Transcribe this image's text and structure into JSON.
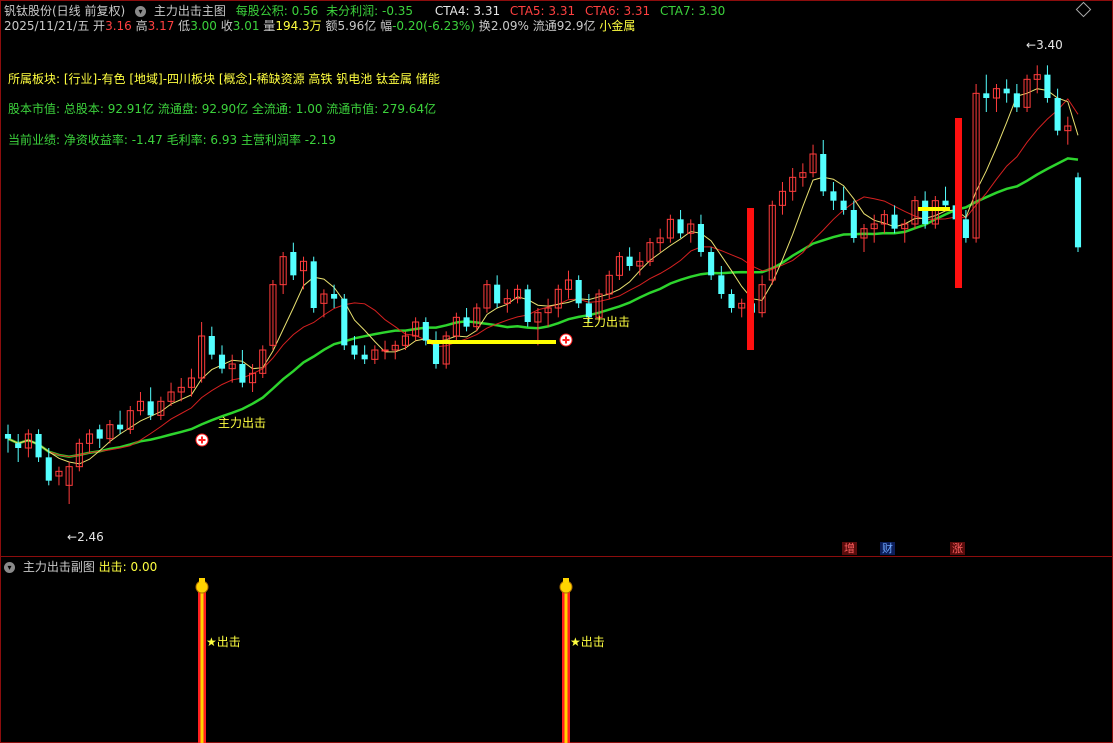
{
  "header": {
    "stock_name": "钒钛股份(日线 前复权)",
    "indicator_title": "主力出击主图",
    "eps_label": "每股公积:",
    "eps_value": "0.56",
    "undist_label": "未分利润:",
    "undist_value": "-0.35",
    "cta4_label": "CTA4:",
    "cta4_value": "3.31",
    "cta5_label": "CTA5:",
    "cta5_value": "3.31",
    "cta6_label": "CTA6:",
    "cta6_value": "3.31",
    "cta7_label": "CTA7:",
    "cta7_value": "3.30"
  },
  "quote": {
    "date": "2025/11/21/五",
    "open_label": "开",
    "open": "3.16",
    "high_label": "高",
    "high": "3.17",
    "low_label": "低",
    "low": "3.00",
    "close_label": "收",
    "close": "3.01",
    "volume_label": "量",
    "volume": "194.3万",
    "amount_label": "额",
    "amount": "5.96亿",
    "change_label": "幅",
    "change": "-0.20(-6.23%)",
    "turnover_label": "换",
    "turnover": "2.09%",
    "float_label": "流通",
    "float_value": "92.9亿",
    "sector_tag": "小金属"
  },
  "info": {
    "sector_line": "所属板块: [行业]-有色 [地域]-四川板块 [概念]-稀缺资源 高铁 钒电池 钛金属 储能",
    "capital_line": "股本市值: 总股本: 92.91亿 流通盘: 92.90亿 全流通: 1.00 流通市值: 279.64亿",
    "perf_line": "当前业绩: 净资收益率: -1.47 毛利率: 6.93 主营利润率 -2.19"
  },
  "chart_labels": {
    "signal_label_1": "主力出击",
    "signal_label_2": "主力出击",
    "max_label": "3.40",
    "min_label": "2.46",
    "badge_zeng": "增",
    "badge_cai": "财",
    "badge_zhang": "涨"
  },
  "sub_panel": {
    "title": "主力出击副图",
    "value_label": "出击:",
    "value": "0.00",
    "signal_text_1": "★出击",
    "signal_text_2": "★出击"
  },
  "colors": {
    "up": "#ff3c3c",
    "down": "#54ffff",
    "ma_green": "#2dd42d",
    "accent_yellow": "#ffff00",
    "frame": "#8c0d0d"
  },
  "icons": {
    "collapse_indicator": "chevron-down-circle-icon",
    "top_right": "diamond-icon",
    "signal_marker": "plus-circle-icon",
    "money_bag": "money-bag-icon"
  },
  "chart_data": {
    "type": "candlestick",
    "y_range": [
      2.4,
      3.45
    ],
    "max_price": 3.4,
    "min_price": 2.46,
    "candles": [
      [
        2.61,
        2.63,
        2.57,
        2.6
      ],
      [
        2.59,
        2.61,
        2.55,
        2.58
      ],
      [
        2.58,
        2.62,
        2.56,
        2.61
      ],
      [
        2.61,
        2.62,
        2.55,
        2.56
      ],
      [
        2.56,
        2.58,
        2.5,
        2.51
      ],
      [
        2.52,
        2.54,
        2.5,
        2.53
      ],
      [
        2.5,
        2.55,
        2.46,
        2.54
      ],
      [
        2.54,
        2.6,
        2.53,
        2.59
      ],
      [
        2.59,
        2.62,
        2.57,
        2.61
      ],
      [
        2.62,
        2.63,
        2.58,
        2.6
      ],
      [
        2.6,
        2.64,
        2.59,
        2.63
      ],
      [
        2.63,
        2.66,
        2.61,
        2.62
      ],
      [
        2.62,
        2.67,
        2.61,
        2.66
      ],
      [
        2.66,
        2.7,
        2.65,
        2.68
      ],
      [
        2.68,
        2.71,
        2.64,
        2.65
      ],
      [
        2.65,
        2.69,
        2.64,
        2.68
      ],
      [
        2.68,
        2.72,
        2.67,
        2.7
      ],
      [
        2.7,
        2.73,
        2.68,
        2.71
      ],
      [
        2.71,
        2.75,
        2.69,
        2.73
      ],
      [
        2.73,
        2.85,
        2.72,
        2.82
      ],
      [
        2.82,
        2.84,
        2.77,
        2.78
      ],
      [
        2.78,
        2.8,
        2.74,
        2.75
      ],
      [
        2.75,
        2.78,
        2.72,
        2.76
      ],
      [
        2.76,
        2.79,
        2.71,
        2.72
      ],
      [
        2.72,
        2.76,
        2.7,
        2.74
      ],
      [
        2.74,
        2.8,
        2.73,
        2.79
      ],
      [
        2.8,
        2.94,
        2.79,
        2.93
      ],
      [
        2.93,
        3.0,
        2.91,
        2.99
      ],
      [
        3.0,
        3.02,
        2.94,
        2.95
      ],
      [
        2.96,
        2.99,
        2.92,
        2.98
      ],
      [
        2.98,
        2.99,
        2.87,
        2.88
      ],
      [
        2.89,
        2.92,
        2.86,
        2.91
      ],
      [
        2.91,
        2.93,
        2.88,
        2.9
      ],
      [
        2.9,
        2.91,
        2.79,
        2.8
      ],
      [
        2.8,
        2.82,
        2.77,
        2.78
      ],
      [
        2.78,
        2.8,
        2.76,
        2.77
      ],
      [
        2.77,
        2.8,
        2.76,
        2.79
      ],
      [
        2.79,
        2.81,
        2.77,
        2.79
      ],
      [
        2.79,
        2.81,
        2.77,
        2.8
      ],
      [
        2.8,
        2.83,
        2.79,
        2.82
      ],
      [
        2.82,
        2.86,
        2.81,
        2.85
      ],
      [
        2.85,
        2.86,
        2.8,
        2.81
      ],
      [
        2.81,
        2.83,
        2.75,
        2.76
      ],
      [
        2.76,
        2.83,
        2.75,
        2.82
      ],
      [
        2.82,
        2.87,
        2.81,
        2.86
      ],
      [
        2.86,
        2.88,
        2.83,
        2.84
      ],
      [
        2.84,
        2.89,
        2.83,
        2.88
      ],
      [
        2.88,
        2.94,
        2.87,
        2.93
      ],
      [
        2.93,
        2.95,
        2.88,
        2.89
      ],
      [
        2.89,
        2.92,
        2.87,
        2.9
      ],
      [
        2.9,
        2.93,
        2.89,
        2.92
      ],
      [
        2.92,
        2.93,
        2.84,
        2.85
      ],
      [
        2.85,
        2.88,
        2.8,
        2.87
      ],
      [
        2.87,
        2.9,
        2.84,
        2.88
      ],
      [
        2.88,
        2.93,
        2.86,
        2.92
      ],
      [
        2.92,
        2.96,
        2.9,
        2.94
      ],
      [
        2.94,
        2.95,
        2.88,
        2.89
      ],
      [
        2.89,
        2.91,
        2.85,
        2.86
      ],
      [
        2.86,
        2.92,
        2.85,
        2.91
      ],
      [
        2.91,
        2.96,
        2.9,
        2.95
      ],
      [
        2.95,
        3.0,
        2.94,
        2.99
      ],
      [
        2.99,
        3.01,
        2.96,
        2.97
      ],
      [
        2.97,
        3.0,
        2.95,
        2.98
      ],
      [
        2.98,
        3.03,
        2.97,
        3.02
      ],
      [
        3.02,
        3.05,
        3.0,
        3.03
      ],
      [
        3.03,
        3.08,
        3.02,
        3.07
      ],
      [
        3.07,
        3.09,
        3.03,
        3.04
      ],
      [
        3.04,
        3.07,
        3.02,
        3.06
      ],
      [
        3.06,
        3.08,
        2.99,
        3.0
      ],
      [
        3.0,
        3.01,
        2.94,
        2.95
      ],
      [
        2.95,
        2.97,
        2.9,
        2.91
      ],
      [
        2.91,
        2.92,
        2.87,
        2.88
      ],
      [
        2.88,
        2.9,
        2.86,
        2.89
      ],
      [
        2.89,
        2.91,
        2.86,
        2.87
      ],
      [
        2.87,
        2.95,
        2.86,
        2.93
      ],
      [
        2.94,
        3.11,
        2.93,
        3.1
      ],
      [
        3.1,
        3.15,
        3.08,
        3.13
      ],
      [
        3.13,
        3.18,
        3.11,
        3.16
      ],
      [
        3.16,
        3.19,
        3.14,
        3.17
      ],
      [
        3.17,
        3.23,
        3.16,
        3.21
      ],
      [
        3.21,
        3.24,
        3.12,
        3.13
      ],
      [
        3.13,
        3.15,
        3.09,
        3.11
      ],
      [
        3.11,
        3.14,
        3.08,
        3.09
      ],
      [
        3.09,
        3.11,
        3.02,
        3.03
      ],
      [
        3.03,
        3.06,
        3.0,
        3.05
      ],
      [
        3.05,
        3.08,
        3.02,
        3.06
      ],
      [
        3.06,
        3.09,
        3.04,
        3.08
      ],
      [
        3.08,
        3.1,
        3.04,
        3.05
      ],
      [
        3.05,
        3.07,
        3.02,
        3.06
      ],
      [
        3.06,
        3.12,
        3.05,
        3.11
      ],
      [
        3.11,
        3.13,
        3.05,
        3.06
      ],
      [
        3.06,
        3.12,
        3.05,
        3.11
      ],
      [
        3.11,
        3.14,
        3.09,
        3.1
      ],
      [
        3.1,
        3.13,
        3.06,
        3.07
      ],
      [
        3.07,
        3.09,
        3.02,
        3.03
      ],
      [
        3.03,
        3.36,
        3.02,
        3.34
      ],
      [
        3.34,
        3.38,
        3.3,
        3.33
      ],
      [
        3.33,
        3.36,
        3.3,
        3.35
      ],
      [
        3.35,
        3.37,
        3.32,
        3.34
      ],
      [
        3.34,
        3.36,
        3.3,
        3.31
      ],
      [
        3.31,
        3.38,
        3.3,
        3.37
      ],
      [
        3.37,
        3.4,
        3.34,
        3.38
      ],
      [
        3.38,
        3.4,
        3.32,
        3.33
      ],
      [
        3.33,
        3.35,
        3.25,
        3.26
      ],
      [
        3.26,
        3.29,
        3.23,
        3.27
      ],
      [
        3.16,
        3.17,
        3.0,
        3.01
      ]
    ]
  }
}
